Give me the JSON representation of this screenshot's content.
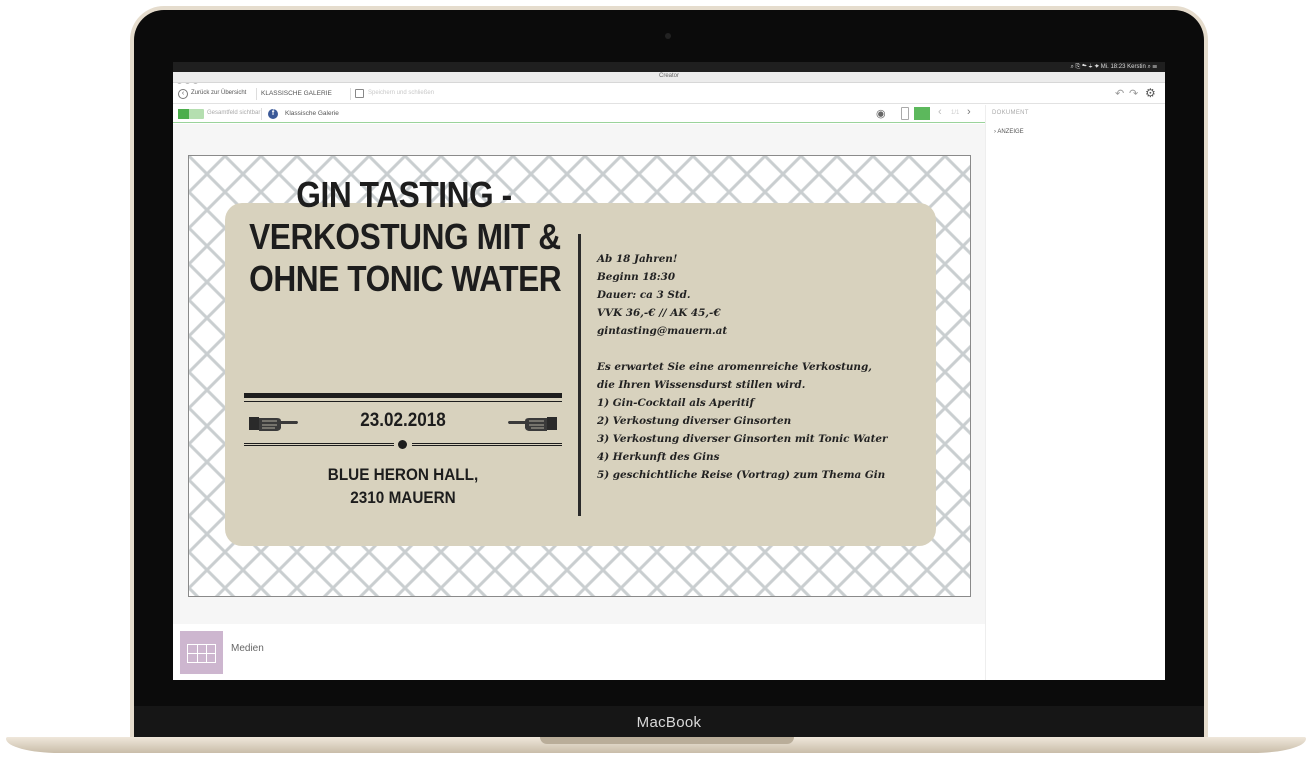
{
  "device": {
    "brand": "MacBook"
  },
  "menubar": {
    "status": "⌕ ⎘ ☁ ⏚ ✦ Mi. 18:23  Kerstin  ⌕ ☰"
  },
  "window": {
    "title": "Creator"
  },
  "toolbar": {
    "back_label": "Zurück zur Übersicht",
    "page_title": "KLASSISCHE GALERIE",
    "save_label": "Speichern und schließen",
    "undo_icon": "undo-icon",
    "redo_icon": "redo-icon",
    "settings_icon": "gear-icon"
  },
  "subbar": {
    "toggle_label": "Gesamtfeld sichtbar",
    "gallery_label": "Klassische Galerie",
    "page_indicator": "1/1"
  },
  "side_panel": {
    "title": "DOKUMENT",
    "items": [
      {
        "label": "ANZEIGE"
      }
    ]
  },
  "flyer": {
    "headline": [
      "GIN TASTING -",
      "VERKOSTUNG MIT &",
      "OHNE TONIC WATER"
    ],
    "date": "23.02.2018",
    "venue": [
      "BLUE HERON HALL,",
      "2310 MAUERN"
    ],
    "info_lines": [
      "Ab 18 Jahren!",
      "Beginn 18:30",
      "Dauer: ca 3 Std.",
      "VVK 36,-€ // AK 45,-€",
      "gintasting@mauern.at"
    ],
    "program_intro": [
      "Es erwartet Sie eine aromenreiche Verkostung,",
      "die Ihren Wissensdurst stillen wird."
    ],
    "program_items": [
      "1) Gin-Cocktail als Aperitif",
      "2) Verkostung diverser Ginsorten",
      "3) Verkostung diverser Ginsorten mit Tonic Water",
      "4) Herkunft des Gins",
      "5) geschichtliche Reise (Vortrag) zum Thema Gin"
    ]
  },
  "bottom": {
    "media_label": "Medien"
  },
  "colors": {
    "accent_green": "#5cb85c",
    "ticket_beige": "#d8d2be",
    "media_purple": "#cdb6cf"
  }
}
